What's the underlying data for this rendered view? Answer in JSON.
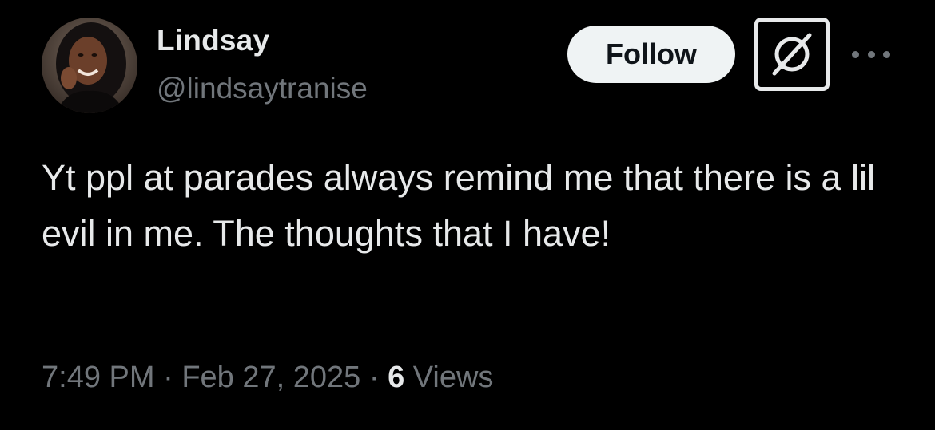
{
  "author": {
    "display_name": "Lindsay",
    "handle": "@lindsaytranise",
    "avatar_icon": "profile-photo"
  },
  "actions": {
    "follow_label": "Follow",
    "grok_icon": "grok-icon",
    "more_icon": "more-horizontal-icon"
  },
  "tweet": {
    "text": "Yt ppl at parades always remind me that there is a lil evil in me. The thoughts that I have!"
  },
  "meta": {
    "time": "7:49 PM",
    "separator": " · ",
    "date": "Feb 27, 2025",
    "views_count": "6",
    "views_label": " Views"
  },
  "colors": {
    "background": "#000000",
    "primary_text": "#e7e9ea",
    "secondary_text": "#71767b",
    "follow_bg": "#eff3f4",
    "follow_text": "#0f1419"
  }
}
